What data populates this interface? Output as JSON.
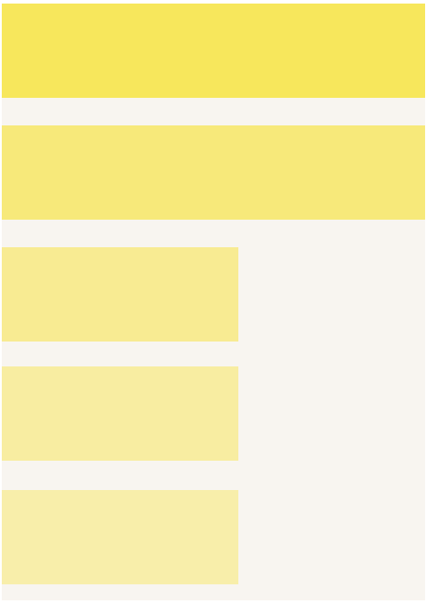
{
  "colors": {
    "background": "#f8f5f0",
    "blocks": [
      "#f7e75c",
      "#f7e97a",
      "#f8eb92",
      "#f8eda1",
      "#f8eeaa"
    ]
  },
  "blocks": [
    {
      "name": "block-1",
      "color_index": 0
    },
    {
      "name": "block-2",
      "color_index": 1
    },
    {
      "name": "block-3",
      "color_index": 2
    },
    {
      "name": "block-4",
      "color_index": 3
    },
    {
      "name": "block-5",
      "color_index": 4
    }
  ]
}
